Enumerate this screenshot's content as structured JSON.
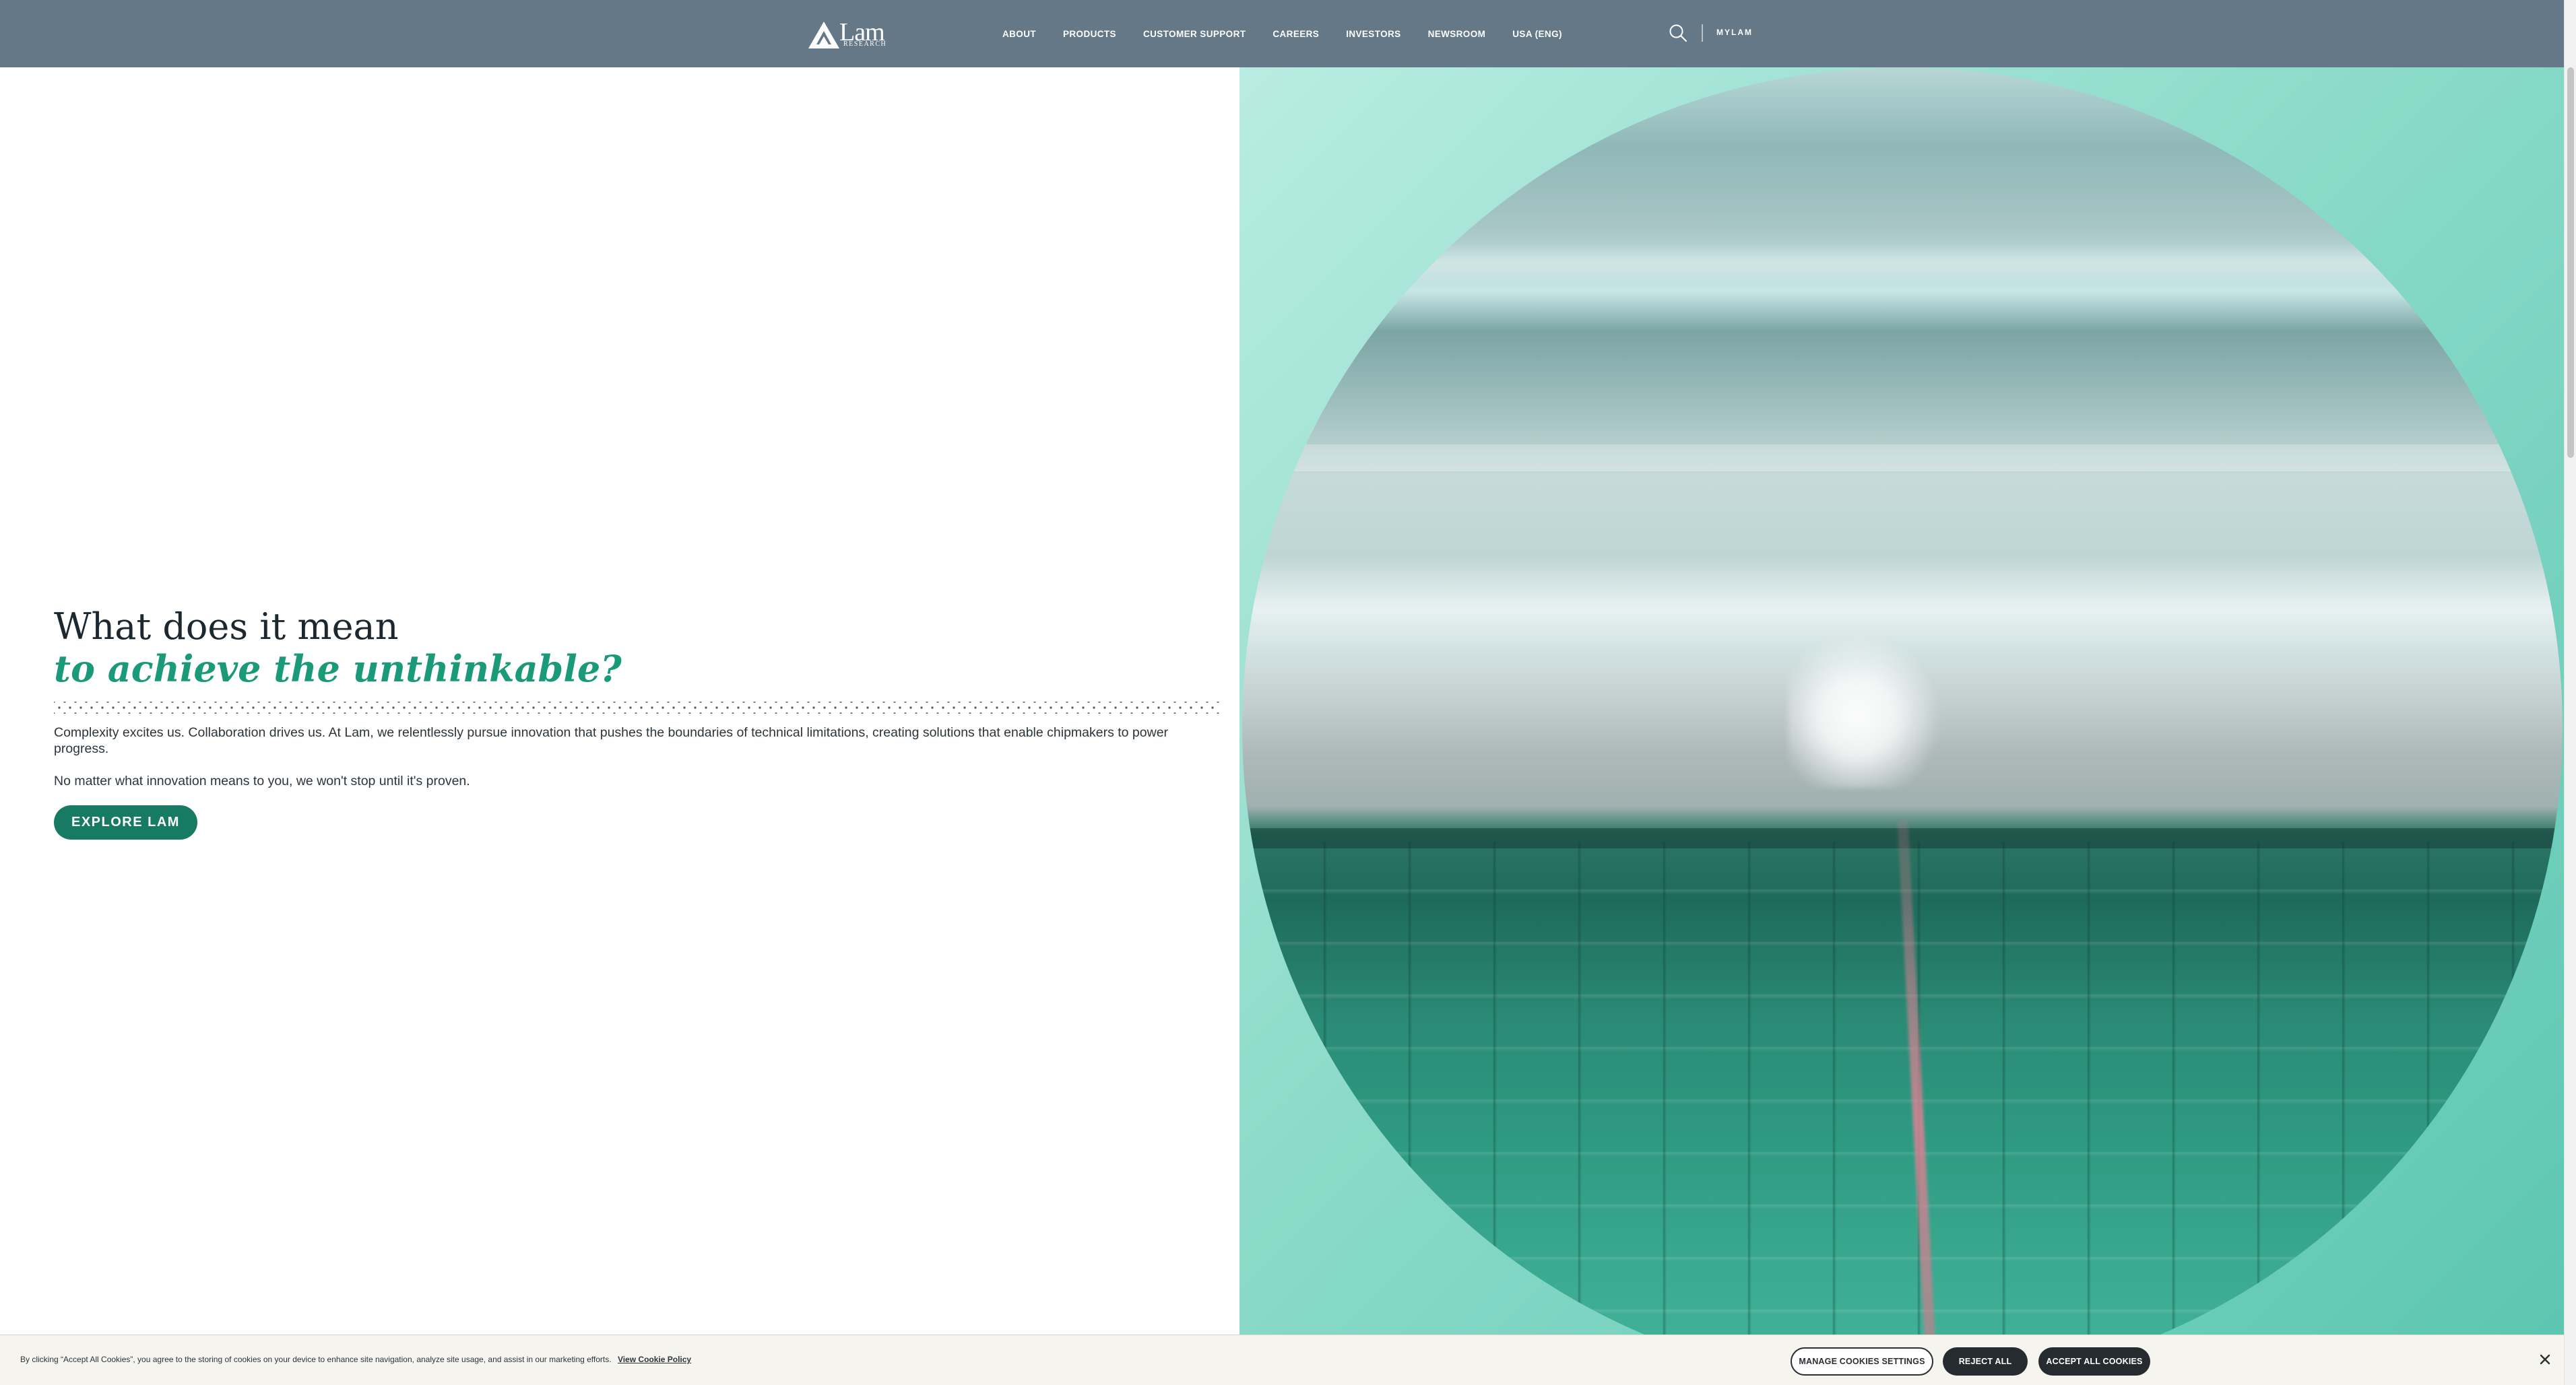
{
  "header": {
    "logo": {
      "name": "Lam",
      "subtitle": "RESEARCH"
    },
    "nav": [
      "ABOUT",
      "PRODUCTS",
      "CUSTOMER SUPPORT",
      "CAREERS",
      "INVESTORS",
      "NEWSROOM",
      "USA (ENG)"
    ],
    "mylam": "MYLAM",
    "colors": {
      "bar": "#647887"
    }
  },
  "hero": {
    "title_line1": "What does it mean",
    "title_line2": "to achieve the unthinkable?",
    "paragraph1": "Complexity excites us. Collaboration drives us. At Lam, we relentlessly pursue innovation that pushes the boundaries of technical limitations, creating solutions that enable chipmakers to power progress.",
    "paragraph2": "No matter what innovation means to you, we won't stop until it's proven.",
    "cta": "EXPLORE LAM",
    "colors": {
      "accent": "#1a9a78",
      "button": "#177a62"
    }
  },
  "cookie_banner": {
    "text": "By clicking “Accept All Cookies”, you agree to the storing of cookies on your device to enhance site navigation, analyze site usage, and assist in our marketing efforts.",
    "link": "View Cookie Policy",
    "manage": "MANAGE COOKIES SETTINGS",
    "reject": "REJECT ALL",
    "accept": "ACCEPT ALL COOKIES",
    "close_icon": "close-icon"
  }
}
